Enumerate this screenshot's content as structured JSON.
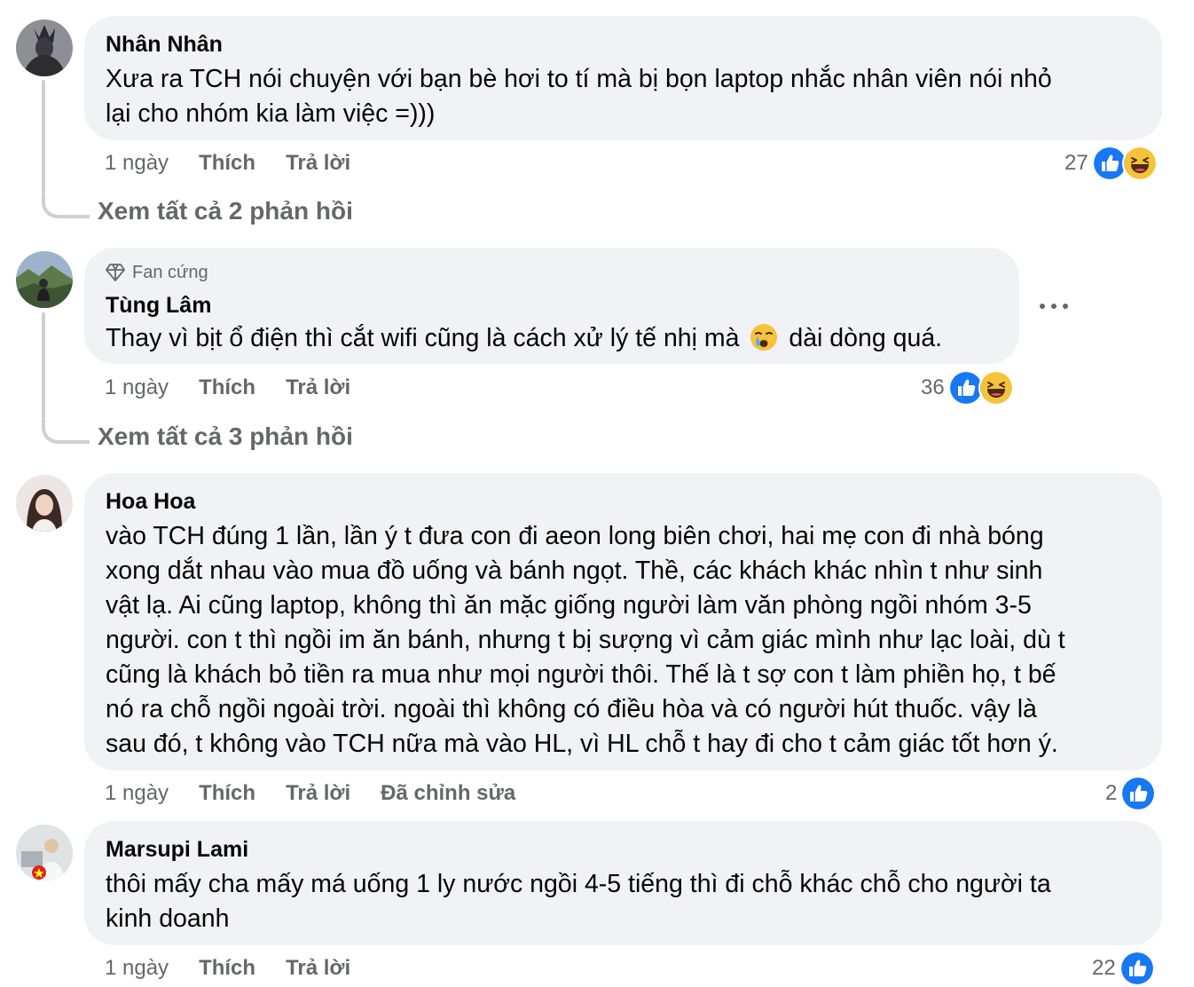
{
  "comments": [
    {
      "author": "Nhân Nhân",
      "text_lines": [
        "Xưa ra TCH nói chuyện với bạn bè hơi to tí mà bị bọn laptop nhắc nhân viên nói nhỏ",
        "lại cho nhóm kia làm việc =)))"
      ],
      "time": "1 ngày",
      "like_label": "Thích",
      "reply_label": "Trả lời",
      "reaction_count": "27",
      "reactions": [
        "like-icon",
        "haha-icon"
      ],
      "see_replies": "Xem tất cả 2 phản hồi"
    },
    {
      "badge": "Fan cứng",
      "author": "Tùng Lâm",
      "text_before": "Thay vì bịt ổ điện thì cắt wifi cũng là cách xử lý tế nhị mà",
      "text_after": "dài dòng quá.",
      "inline_emoji": "crying-face-emoji",
      "time": "1 ngày",
      "like_label": "Thích",
      "reply_label": "Trả lời",
      "reaction_count": "36",
      "reactions": [
        "like-icon",
        "haha-icon"
      ],
      "see_replies": "Xem tất cả 3 phản hồi"
    },
    {
      "author": "Hoa Hoa",
      "text_lines": [
        "vào TCH đúng 1 lần, lần ý t đưa con đi aeon long biên chơi, hai mẹ con đi nhà bóng",
        "xong dắt nhau vào mua đồ uống và bánh ngọt. Thề, các khách khác nhìn t như sinh",
        "vật lạ. Ai cũng laptop, không thì ăn mặc giống người làm văn phòng ngồi nhóm 3-5",
        "người. con t thì ngồi im ăn bánh, nhưng t bị sượng vì cảm giác mình như lạc loài, dù t",
        "cũng là khách bỏ tiền ra mua như mọi người thôi. Thế là t sợ con t làm phiền họ, t bế",
        "nó ra chỗ ngồi ngoài trời. ngoài thì không có điều hòa và có người hút thuốc. vậy là",
        "sau đó, t không vào TCH nữa mà vào HL, vì HL chỗ t hay đi cho t cảm giác tốt hơn ý."
      ],
      "time": "1 ngày",
      "like_label": "Thích",
      "reply_label": "Trả lời",
      "edited_label": "Đã chỉnh sửa",
      "reaction_count": "2",
      "reactions": [
        "like-icon"
      ]
    },
    {
      "author": "Marsupi Lami",
      "text_lines": [
        "thôi mấy cha mấy má uống 1 ly nước ngồi 4-5 tiếng thì đi chỗ khác chỗ cho người ta",
        "kinh doanh"
      ],
      "time": "1 ngày",
      "like_label": "Thích",
      "reply_label": "Trả lời",
      "reaction_count": "22",
      "reactions": [
        "like-icon"
      ]
    }
  ],
  "colors": {
    "bubble": "#f0f2f5",
    "secondary_text": "#65676b",
    "like_blue": "#1877f2",
    "haha_yellow": "#f5c33b",
    "thread_line": "#ced0d4"
  }
}
